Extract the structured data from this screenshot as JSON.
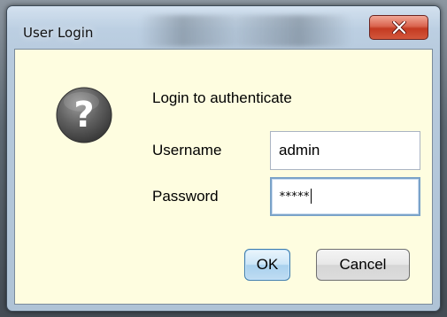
{
  "window": {
    "title": "User Login",
    "close_icon": "close-x-icon"
  },
  "dialog": {
    "icon": "question-icon",
    "prompt": "Login to authenticate",
    "username": {
      "label": "Username",
      "value": "admin"
    },
    "password": {
      "label": "Password",
      "value": "*****"
    },
    "buttons": {
      "ok_label": "OK",
      "cancel_label": "Cancel"
    }
  },
  "colors": {
    "content_background": "#fefde0",
    "close_button": "#c43a22",
    "focus_border": "#7aa2c8"
  }
}
